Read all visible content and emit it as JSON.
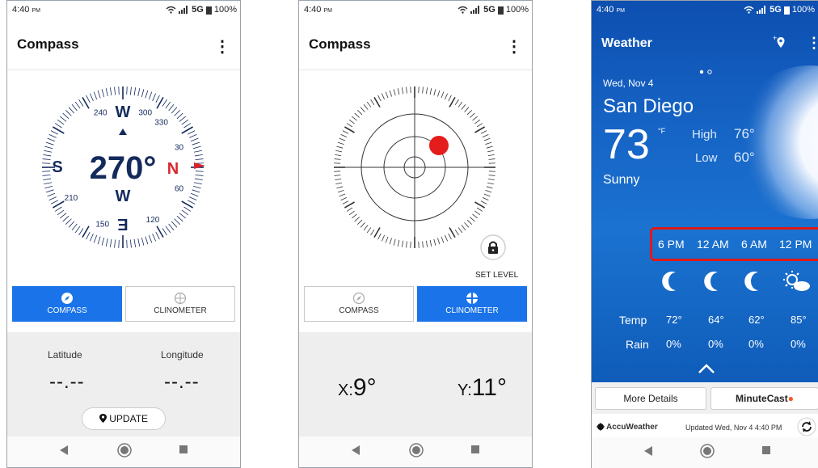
{
  "status": {
    "time": "4:40",
    "ampm": "PM",
    "network": "5G",
    "battery": "100%"
  },
  "compass": {
    "title": "Compass",
    "heading": "270°",
    "letter_n": "N",
    "letter_s": "S",
    "letter_w": "W",
    "letter_e": "E",
    "dial_numbers": [
      "240",
      "300",
      "330",
      "30",
      "60",
      "120",
      "150",
      "210"
    ],
    "tab_compass": "COMPASS",
    "tab_clinometer": "CLINOMETER",
    "latitude_label": "Latitude",
    "longitude_label": "Longitude",
    "latitude_value": "--.--",
    "longitude_value": "--.--",
    "update_label": "UPDATE"
  },
  "clinometer": {
    "title": "Compass",
    "set_level": "SET LEVEL",
    "tab_compass": "COMPASS",
    "tab_clinometer": "CLINOMETER",
    "x_label": "X:",
    "x_value": "9°",
    "y_label": "Y:",
    "y_value": "11°"
  },
  "weather": {
    "title": "Weather",
    "date": "Wed, Nov 4",
    "city": "San Diego",
    "temp": "73",
    "unit": "°F",
    "high_label": "High",
    "high_value": "76°",
    "low_label": "Low",
    "low_value": "60°",
    "condition": "Sunny",
    "hours": [
      "6 PM",
      "12 AM",
      "6 AM",
      "12 PM"
    ],
    "temp_label": "Temp",
    "temps": [
      "72°",
      "64°",
      "62°",
      "85°"
    ],
    "rain_label": "Rain",
    "rains": [
      "0%",
      "0%",
      "0%",
      "0%"
    ],
    "more_details": "More Details",
    "minutecast": "MinuteCast",
    "brand": "AccuWeather",
    "updated": "Updated Wed, Nov 4 4:40 PM"
  },
  "colors": {
    "accent": "#1a73e8",
    "navy": "#142a5c",
    "alert_red": "#e01818",
    "sky": "#1665c6"
  }
}
